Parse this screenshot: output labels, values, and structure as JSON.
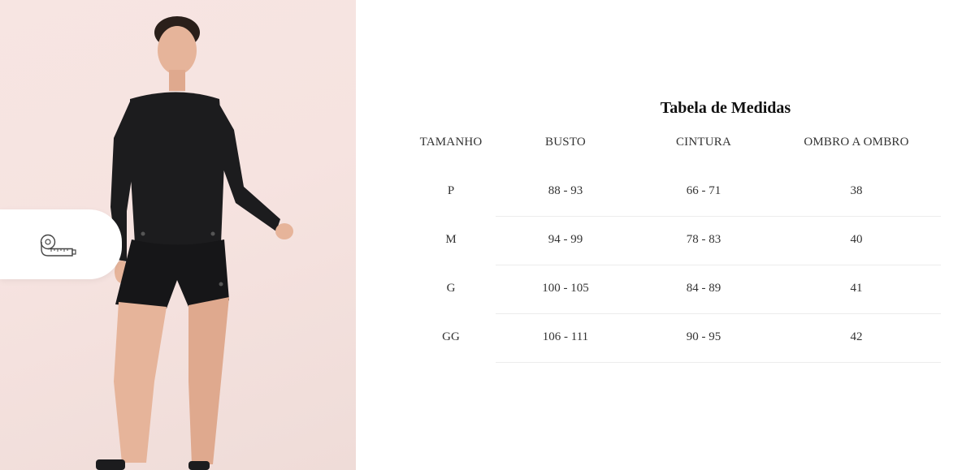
{
  "photo": {
    "alt": "",
    "measure_icon": "measuring-tape-icon"
  },
  "size_table": {
    "title": "Tabela de Medidas",
    "headers": [
      "TAMANHO",
      "BUSTO",
      "CINTURA",
      "OMBRO A OMBRO"
    ],
    "rows": [
      [
        "P",
        "88 - 93",
        "66 - 71",
        "38"
      ],
      [
        "M",
        "94 - 99",
        "78 - 83",
        "40"
      ],
      [
        "G",
        "100 - 105",
        "84 - 89",
        "41"
      ],
      [
        "GG",
        "106 - 111",
        "90 - 95",
        "42"
      ]
    ]
  },
  "colors": {
    "background": "#ffffff",
    "photo_background": "#f6e3e0",
    "garment": "#1c1c1e",
    "skin": "#e6b49a",
    "divider": "#ececec"
  }
}
